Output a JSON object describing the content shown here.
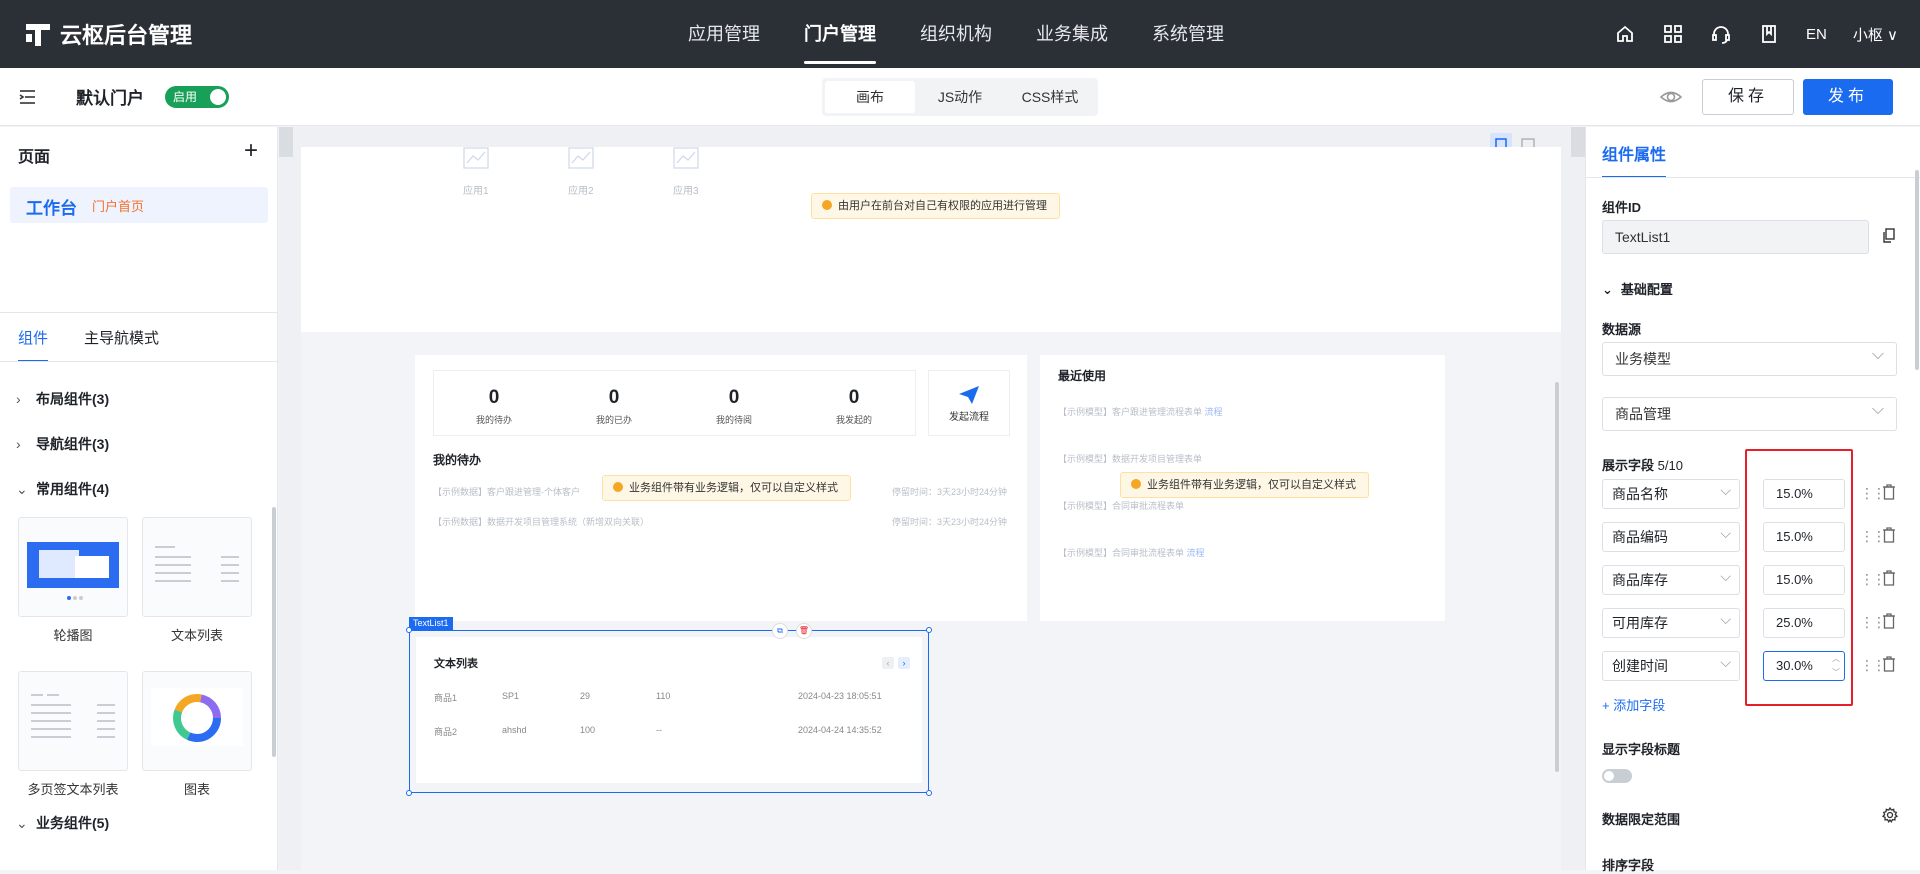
{
  "topbar": {
    "app_title": "云枢后台管理",
    "nav": [
      "应用管理",
      "门户管理",
      "组织机构",
      "业务集成",
      "系统管理"
    ],
    "lang": "EN",
    "user": "小枢"
  },
  "subbar": {
    "portal_name": "默认门户",
    "status": "启用",
    "mode_tabs": [
      "画布",
      "JS动作",
      "CSS样式"
    ],
    "save": "保存",
    "publish": "发布"
  },
  "left": {
    "pages_title": "页面",
    "page_name": "工作台",
    "page_tag": "门户首页",
    "tabs": [
      "组件",
      "主导航模式"
    ],
    "groups": [
      "布局组件(3)",
      "导航组件(3)",
      "常用组件(4)",
      "业务组件(5)"
    ],
    "cards": [
      "轮播图",
      "文本列表",
      "多页签文本列表",
      "图表"
    ]
  },
  "canvas": {
    "apps": [
      "应用1",
      "应用2",
      "应用3"
    ],
    "hint_apps": "由用户在前台对自己有权限的应用进行管理",
    "stats": [
      {
        "num": "0",
        "label": "我的待办"
      },
      {
        "num": "0",
        "label": "我的已办"
      },
      {
        "num": "0",
        "label": "我的待阅"
      },
      {
        "num": "0",
        "label": "我发起的"
      }
    ],
    "launch": "发起流程",
    "todo_title": "我的待办",
    "todo_lines": [
      {
        "text": "【示例数据】客户跟进管理-个体客户",
        "meta": "停留时间：3天23小时24分钟"
      },
      {
        "text": "【示例数据】数据开发项目管理系统（新增双向关联）",
        "meta": "停留时间：3天23小时24分钟"
      }
    ],
    "hint_biz": "业务组件带有业务逻辑，仅可以自定义样式",
    "recent_title": "最近使用",
    "recent_lines": [
      {
        "text": "【示例模型】客户跟进管理流程表单",
        "badge": "流程"
      },
      {
        "text": "【示例模型】数据开发项目管理表单",
        "badge": ""
      },
      {
        "text": "【示例模型】合同审批流程表单",
        "badge": ""
      },
      {
        "text": "【示例模型】合同审批流程表单",
        "badge": "流程"
      }
    ],
    "selected_tag": "TextList1",
    "textlist_title": "文本列表",
    "textlist_rows": [
      [
        "商品1",
        "SP1",
        "29",
        "110",
        "2024-04-23 18:05:51"
      ],
      [
        "商品2",
        "ahshd",
        "100",
        "--",
        "2024-04-24 14:35:52"
      ]
    ]
  },
  "right": {
    "title": "组件属性",
    "id_label": "组件ID",
    "id_value": "TextList1",
    "basic_config": "基础配置",
    "datasource_label": "数据源",
    "datasource_value": "业务模型",
    "model_value": "商品管理",
    "fields_label": "展示字段",
    "fields_count": "5/10",
    "fields": [
      {
        "name": "商品名称",
        "width": "15.0%"
      },
      {
        "name": "商品编码",
        "width": "15.0%"
      },
      {
        "name": "商品库存",
        "width": "15.0%"
      },
      {
        "name": "可用库存",
        "width": "25.0%"
      },
      {
        "name": "创建时间",
        "width": "30.0%"
      }
    ],
    "add_field": "+ 添加字段",
    "show_title_label": "显示字段标题",
    "scope_label": "数据限定范围",
    "sort_label": "排序字段"
  },
  "colors": {
    "primary": "#1a6bf0",
    "header_bg": "#2b2f36",
    "highlight": "#e5202b",
    "tag_orange": "#f5712e",
    "enabled": "#18a058"
  }
}
